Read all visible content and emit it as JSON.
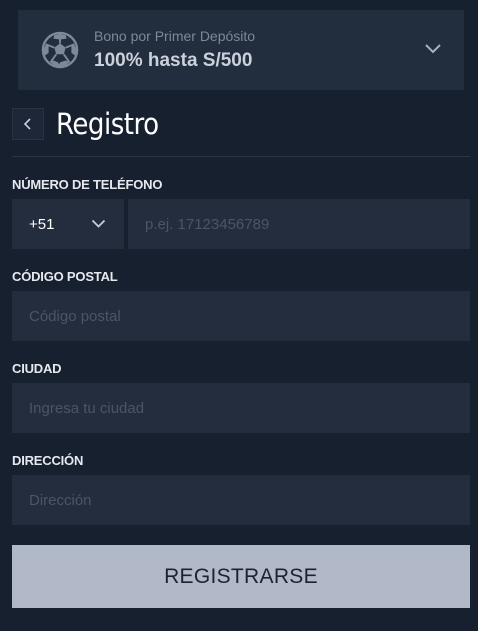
{
  "bonus": {
    "subtitle": "Bono por Primer Depósito",
    "headline": "100% hasta S/500",
    "icon": "soccer-ball-icon"
  },
  "page": {
    "title": "Registro",
    "back_icon": "chevron-left-icon"
  },
  "form": {
    "phone": {
      "label": "NÚMERO DE TELÉFONO",
      "prefix": "+51",
      "placeholder": "p.ej. 17123456789"
    },
    "postal": {
      "label": "CÓDIGO POSTAL",
      "placeholder": "Código postal"
    },
    "city": {
      "label": "CIUDAD",
      "placeholder": "Ingresa tu ciudad"
    },
    "address": {
      "label": "DIRECCIÓN",
      "placeholder": "Dirección"
    },
    "submit_label": "REGISTRARSE"
  },
  "colors": {
    "background": "#17202f",
    "panel": "#222d3d",
    "input": "#232d3d",
    "button": "#b1b9c9",
    "button_text": "#1a2233"
  }
}
